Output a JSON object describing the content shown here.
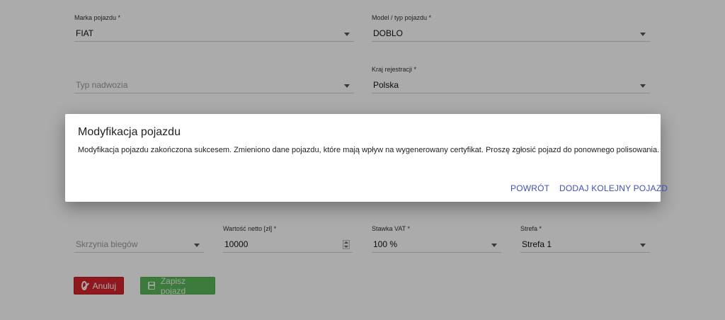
{
  "form": {
    "marka": {
      "label": "Marka pojazdu *",
      "value": "FIAT"
    },
    "model": {
      "label": "Model / typ pojazdu *",
      "value": "DOBLO"
    },
    "typ_nadwozia": {
      "placeholder": "Typ nadwozia"
    },
    "kraj": {
      "label": "Kraj rejestracji *",
      "value": "Polska"
    },
    "skrzynia": {
      "placeholder": "Skrzynia biegów"
    },
    "wartosc": {
      "label": "Wartość netto [zł] *",
      "value": "10000"
    },
    "vat": {
      "label": "Stawka VAT *",
      "value": "100 %"
    },
    "strefa": {
      "label": "Strefa *",
      "value": "Strefa 1"
    }
  },
  "buttons": {
    "cancel": {
      "label": "Anuluj",
      "icon": "ban-icon"
    },
    "save": {
      "label": "Zapisz pojazd",
      "icon": "floppy-disk-icon"
    }
  },
  "dialog": {
    "title": "Modyfikacja pojazdu",
    "message": "Modyfikacja pojazdu zakończona sukcesem. Zmieniono dane pojazdu, które mają wpływ na wygenerowany certyfikat. Proszę zgłosić pojazd do ponownego polisowania.",
    "actions": {
      "back": "POWRÓT",
      "add_another": "DODAJ KOLEJNY POJAZD"
    },
    "accent_color": "#3f51b5"
  },
  "colors": {
    "cancel": "#d9232d",
    "save": "#5cb85c",
    "overlay": "rgba(0,0,0,0.33)"
  }
}
